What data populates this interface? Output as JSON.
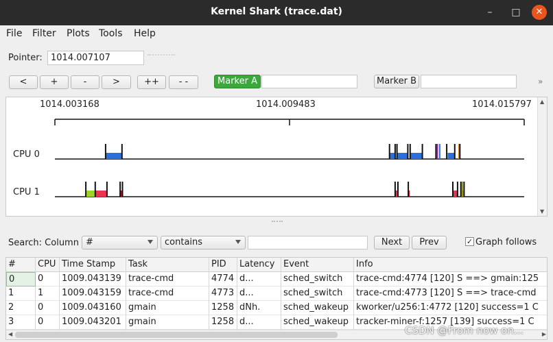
{
  "window": {
    "title": "Kernel Shark (trace.dat)",
    "minimize": "–",
    "maximize": "□",
    "close": "✕"
  },
  "menu": [
    "File",
    "Filter",
    "Plots",
    "Tools",
    "Help"
  ],
  "pointer": {
    "label": "Pointer:",
    "value": "1014.007107"
  },
  "nav_buttons": [
    "<",
    "+",
    "-",
    ">",
    "++",
    "- -"
  ],
  "marker_a": {
    "label": "Marker A",
    "value": ""
  },
  "marker_b": {
    "label": "Marker B",
    "value": ""
  },
  "overflow_icon": "»",
  "graph": {
    "time_start": "1014.003168",
    "time_mid": "1014.009483",
    "time_end": "1014.015797",
    "cpus": [
      {
        "label": "CPU 0",
        "bars": [
          {
            "from": 0.108,
            "to": 0.143,
            "color": "#2a6fdb"
          },
          {
            "from": 0.714,
            "to": 0.724,
            "color": "#2a6fdb"
          },
          {
            "from": 0.73,
            "to": 0.752,
            "color": "#2a6fdb"
          },
          {
            "from": 0.758,
            "to": 0.783,
            "color": "#2a6fdb"
          },
          {
            "from": 0.837,
            "to": 0.851,
            "color": "#2a6fdb"
          }
        ],
        "ticks": [
          {
            "at": 0.108,
            "color": "#111"
          },
          {
            "at": 0.143,
            "color": "#111"
          },
          {
            "at": 0.713,
            "color": "#111"
          },
          {
            "at": 0.725,
            "color": "#111"
          },
          {
            "at": 0.729,
            "color": "#111"
          },
          {
            "at": 0.752,
            "color": "#111"
          },
          {
            "at": 0.757,
            "color": "#111"
          },
          {
            "at": 0.783,
            "color": "#111"
          },
          {
            "at": 0.812,
            "color": "#111"
          },
          {
            "at": 0.815,
            "color": "#9b27b0"
          },
          {
            "at": 0.82,
            "color": "#2a6fdb"
          },
          {
            "at": 0.835,
            "color": "#111"
          },
          {
            "at": 0.852,
            "color": "#111"
          },
          {
            "at": 0.861,
            "color": "#d08a1a"
          },
          {
            "at": 0.863,
            "color": "#111"
          }
        ]
      },
      {
        "label": "CPU 1",
        "bars": [
          {
            "from": 0.066,
            "to": 0.086,
            "color": "#9fd328"
          },
          {
            "from": 0.086,
            "to": 0.111,
            "color": "#e8344e"
          },
          {
            "from": 0.139,
            "to": 0.144,
            "color": "#c41a2c"
          },
          {
            "from": 0.725,
            "to": 0.73,
            "color": "#e8344e"
          },
          {
            "from": 0.753,
            "to": 0.756,
            "color": "#c41a2c"
          },
          {
            "from": 0.848,
            "to": 0.858,
            "color": "#e8344e"
          },
          {
            "from": 0.865,
            "to": 0.871,
            "color": "#e0c21c"
          }
        ],
        "ticks": [
          {
            "at": 0.066,
            "color": "#111"
          },
          {
            "at": 0.086,
            "color": "#111"
          },
          {
            "at": 0.111,
            "color": "#111"
          },
          {
            "at": 0.139,
            "color": "#111"
          },
          {
            "at": 0.144,
            "color": "#111"
          },
          {
            "at": 0.725,
            "color": "#111"
          },
          {
            "at": 0.731,
            "color": "#111"
          },
          {
            "at": 0.753,
            "color": "#111"
          },
          {
            "at": 0.848,
            "color": "#111"
          },
          {
            "at": 0.858,
            "color": "#111"
          },
          {
            "at": 0.865,
            "color": "#111"
          },
          {
            "at": 0.868,
            "color": "#8a8a00"
          },
          {
            "at": 0.872,
            "color": "#111"
          }
        ]
      }
    ]
  },
  "search": {
    "label": "Search: Column",
    "column": "#",
    "mode": "contains",
    "query": "",
    "next": "Next",
    "prev": "Prev",
    "graph_follows": "Graph follows",
    "graph_follows_checked": true
  },
  "table": {
    "columns": [
      "#",
      "CPU",
      "Time Stamp",
      "Task",
      "PID",
      "Latency",
      "Event",
      "Info"
    ],
    "rows": [
      [
        "0",
        "0",
        "1009.043139",
        "trace-cmd",
        "4774",
        "d...",
        "sched_switch",
        "trace-cmd:4774 [120] S ==> gmain:125"
      ],
      [
        "1",
        "1",
        "1009.043159",
        "trace-cmd",
        "4773",
        "d...",
        "sched_switch",
        "trace-cmd:4773 [120] S ==> trace-cmd"
      ],
      [
        "2",
        "0",
        "1009.043160",
        "gmain",
        "1258",
        "dNh.",
        "sched_wakeup",
        "kworker/u256:1:4772 [120] success=1 C"
      ],
      [
        "3",
        "0",
        "1009.043201",
        "gmain",
        "1258",
        "d...",
        "sched_wakeup",
        "tracker-miner-f:1257 [139] success=1 C"
      ]
    ]
  },
  "watermark": "CSDN @From now on..."
}
